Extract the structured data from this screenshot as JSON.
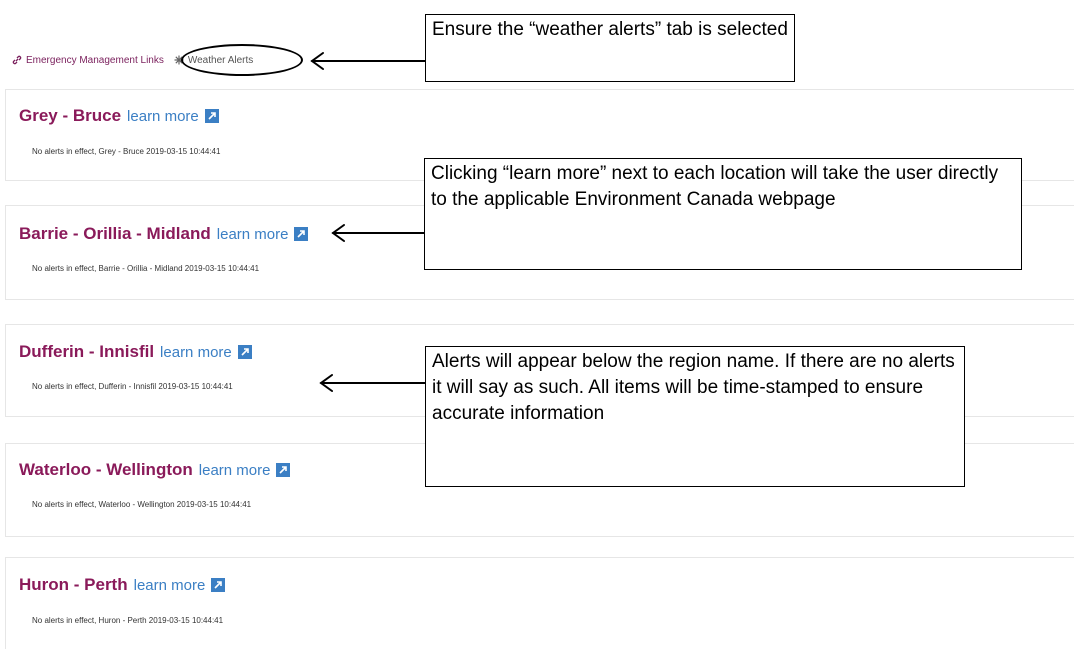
{
  "tabs": {
    "links_label": "Emergency Management Links",
    "weather_label": "Weather Alerts"
  },
  "regions": [
    {
      "name": "Grey - Bruce",
      "learn_more": "learn more",
      "status": "No alerts in effect, Grey - Bruce 2019-03-15 10:44:41"
    },
    {
      "name": "Barrie - Orillia - Midland",
      "learn_more": "learn more",
      "status": "No alerts in effect, Barrie - Orillia - Midland 2019-03-15 10:44:41"
    },
    {
      "name": "Dufferin - Innisfil",
      "learn_more": "learn more",
      "status": "No alerts in effect, Dufferin - Innisfil 2019-03-15 10:44:41"
    },
    {
      "name": "Waterloo - Wellington",
      "learn_more": "learn more",
      "status": "No alerts in effect, Waterloo - Wellington 2019-03-15 10:44:41"
    },
    {
      "name": "Huron - Perth",
      "learn_more": "learn more",
      "status": "No alerts in effect, Huron - Perth 2019-03-15 10:44:41"
    }
  ],
  "callouts": {
    "tab": "Ensure the “weather alerts” tab is selected",
    "learn": "Clicking “learn more” next to each location will take the user directly to the applicable Environment Canada webpage",
    "alerts": "Alerts will appear below the region name. If there are no alerts it will say as such. All items will be time-stamped to ensure accurate information"
  },
  "colors": {
    "region_title": "#8a1a5a",
    "learn_more": "#3b7fc4",
    "link_tab": "#7a1f5c"
  }
}
